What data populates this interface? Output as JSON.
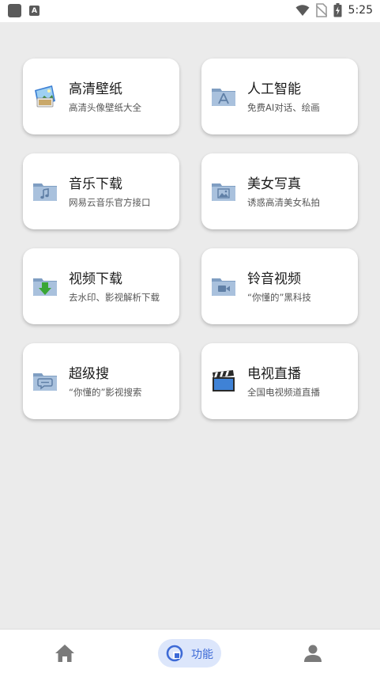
{
  "status_bar": {
    "time": "5:25",
    "notification_letter": "A"
  },
  "cards": [
    {
      "title": "高清壁纸",
      "subtitle": "高清头像壁纸大全",
      "icon": "wallpaper-icon"
    },
    {
      "title": "人工智能",
      "subtitle": "免费AI对话、绘画",
      "icon": "app-folder-icon"
    },
    {
      "title": "音乐下载",
      "subtitle": "网易云音乐官方接口",
      "icon": "music-folder-icon"
    },
    {
      "title": "美女写真",
      "subtitle": "诱惑高清美女私拍",
      "icon": "picture-folder-icon"
    },
    {
      "title": "视频下载",
      "subtitle": "去水印、影视解析下载",
      "icon": "download-folder-icon"
    },
    {
      "title": "铃音视频",
      "subtitle": "“你懂的”黑科技",
      "icon": "video-folder-icon"
    },
    {
      "title": "超级搜",
      "subtitle": "“你懂的”影视搜索",
      "icon": "chat-folder-icon"
    },
    {
      "title": "电视直播",
      "subtitle": "全国电视频道直播",
      "icon": "clapperboard-icon"
    }
  ],
  "bottom_nav": {
    "items": [
      {
        "icon": "home-icon"
      },
      {
        "icon": "function-icon",
        "label": "功能",
        "active": true
      },
      {
        "icon": "user-icon"
      }
    ]
  },
  "colors": {
    "accent": "#3d6ad6",
    "pill_bg": "#dce6fb",
    "page_bg": "#ebebeb"
  }
}
